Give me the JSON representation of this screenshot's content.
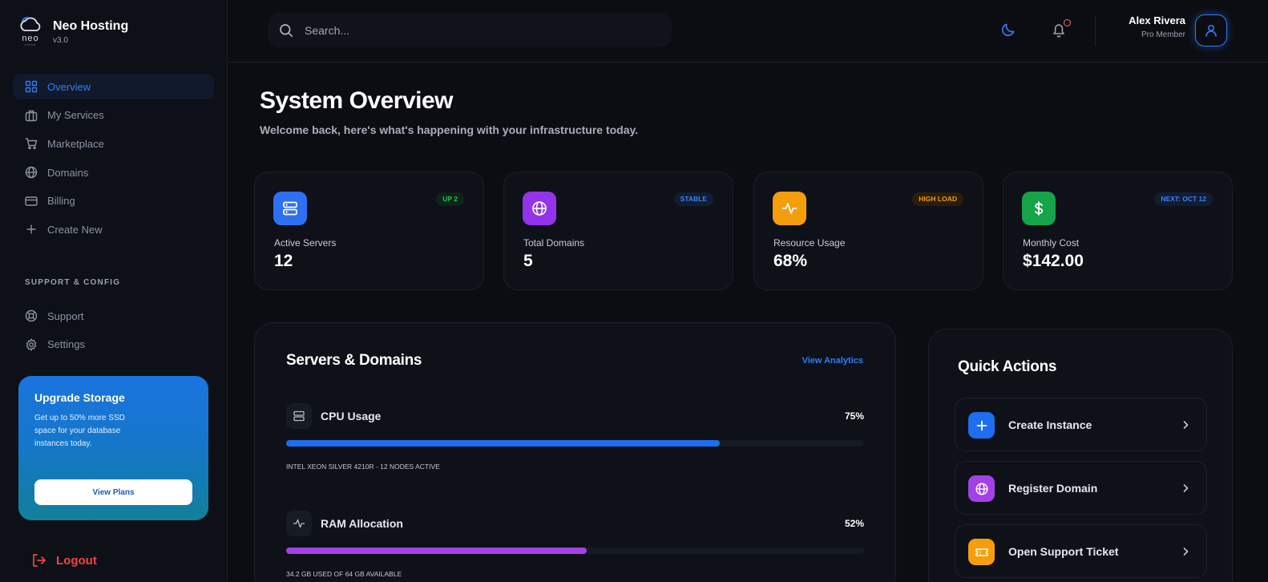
{
  "brand": {
    "logo_word": "neo",
    "logo_sub": "cloud",
    "name": "Neo Hosting",
    "version": "v3.0"
  },
  "nav": {
    "items": [
      {
        "label": "Overview",
        "icon": "grid-icon",
        "active": true
      },
      {
        "label": "My Services",
        "icon": "briefcase-icon"
      },
      {
        "label": "Marketplace",
        "icon": "cart-icon"
      },
      {
        "label": "Domains",
        "icon": "globe-icon"
      },
      {
        "label": "Billing",
        "icon": "credit-card-icon"
      },
      {
        "label": "Create New",
        "icon": "plus-icon"
      }
    ],
    "section_title": "SUPPORT & CONFIG",
    "support_items": [
      {
        "label": "Support",
        "icon": "lifebuoy-icon"
      },
      {
        "label": "Settings",
        "icon": "gear-icon"
      }
    ]
  },
  "upgrade": {
    "title": "Upgrade Storage",
    "description": "Get up to 50% more SSD space for your database instances today.",
    "button": "View Plans"
  },
  "logout_label": "Logout",
  "header": {
    "search_placeholder": "Search...",
    "user_name": "Alex Rivera",
    "user_role": "Pro Member"
  },
  "page": {
    "title": "System Overview",
    "subtitle": "Welcome back, here's what's happening with your infrastructure today."
  },
  "stats": [
    {
      "label": "Active Servers",
      "value": "12",
      "badge": "UP 2",
      "icon": "server-icon",
      "color": "#2f6ff2",
      "badge_color": "#22c55e",
      "badge_bg": "#0f2418"
    },
    {
      "label": "Total Domains",
      "value": "5",
      "badge": "STABLE",
      "icon": "globe-icon",
      "color": "#9333ea",
      "badge_color": "#3b82f6",
      "badge_bg": "#121d33"
    },
    {
      "label": "Resource Usage",
      "value": "68%",
      "badge": "HIGH LOAD",
      "icon": "activity-icon",
      "color": "#f59e0b",
      "badge_color": "#f59e0b",
      "badge_bg": "#2a1d0c"
    },
    {
      "label": "Monthly Cost",
      "value": "$142.00",
      "badge": "NEXT: OCT 12",
      "icon": "dollar-icon",
      "color": "#16a34a",
      "badge_color": "#3b82f6",
      "badge_bg": "#121d33"
    }
  ],
  "servers": {
    "title": "Servers & Domains",
    "link": "View Analytics",
    "metrics": [
      {
        "name": "CPU Usage",
        "percent_label": "75%",
        "fill": 0.75,
        "note": "Intel Xeon Silver 4210R - 12 Nodes Active",
        "color": "#1d6ef0",
        "icon": "server-icon"
      },
      {
        "name": "RAM Allocation",
        "percent_label": "52%",
        "fill": 0.52,
        "note": "34.2 GB USED OF 64 GB AVAILABLE",
        "color": "#a341e6",
        "icon": "activity-icon"
      }
    ]
  },
  "quick_actions": {
    "title": "Quick Actions",
    "items": [
      {
        "label": "Create Instance",
        "icon": "plus-icon",
        "color": "#1d6ef0"
      },
      {
        "label": "Register Domain",
        "icon": "globe-icon",
        "color": "#a341e6"
      },
      {
        "label": "Open Support Ticket",
        "icon": "ticket-icon",
        "color": "#f59e0b"
      }
    ]
  }
}
